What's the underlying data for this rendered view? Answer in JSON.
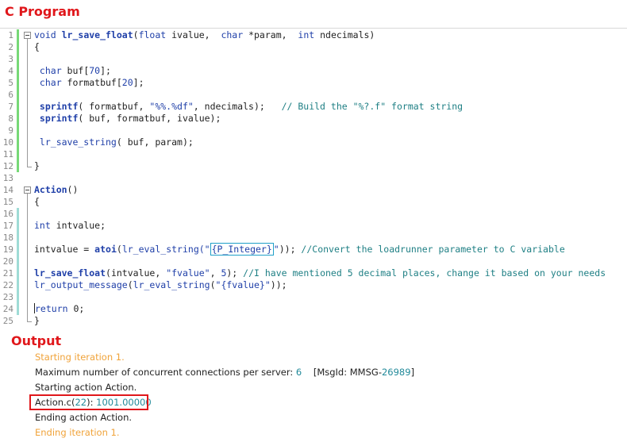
{
  "titles": {
    "code": "C Program",
    "output": "Output"
  },
  "code_lines": [
    {
      "n": "1",
      "tokens": [
        {
          "t": "void ",
          "c": "kw"
        },
        {
          "t": "lr_save_float",
          "c": "fn"
        },
        {
          "t": "(",
          "c": ""
        },
        {
          "t": "float",
          "c": "kw"
        },
        {
          "t": " ivalue,  ",
          "c": ""
        },
        {
          "t": "char",
          "c": "kw"
        },
        {
          "t": " *param,  ",
          "c": ""
        },
        {
          "t": "int",
          "c": "kw"
        },
        {
          "t": " ndecimals)",
          "c": ""
        }
      ]
    },
    {
      "n": "2",
      "tokens": [
        {
          "t": "{",
          "c": ""
        }
      ]
    },
    {
      "n": "3",
      "tokens": []
    },
    {
      "n": "4",
      "tokens": [
        {
          "t": " char",
          "c": "kw"
        },
        {
          "t": " buf[",
          "c": ""
        },
        {
          "t": "70",
          "c": "num"
        },
        {
          "t": "];",
          "c": ""
        }
      ]
    },
    {
      "n": "5",
      "tokens": [
        {
          "t": " char",
          "c": "kw"
        },
        {
          "t": " formatbuf[",
          "c": ""
        },
        {
          "t": "20",
          "c": "num"
        },
        {
          "t": "];",
          "c": ""
        }
      ]
    },
    {
      "n": "6",
      "tokens": []
    },
    {
      "n": "7",
      "tokens": [
        {
          "t": " sprintf",
          "c": "fn"
        },
        {
          "t": "( formatbuf, ",
          "c": ""
        },
        {
          "t": "\"%%.%df\"",
          "c": "str"
        },
        {
          "t": ", ndecimals);   ",
          "c": ""
        },
        {
          "t": "// Build the \"%?.f\" format string",
          "c": "cm"
        }
      ]
    },
    {
      "n": "8",
      "tokens": [
        {
          "t": " sprintf",
          "c": "fn"
        },
        {
          "t": "( buf, formatbuf, ivalue);",
          "c": ""
        }
      ]
    },
    {
      "n": "9",
      "tokens": []
    },
    {
      "n": "10",
      "tokens": [
        {
          "t": " lr_save_string",
          "c": "lr"
        },
        {
          "t": "( buf, param);",
          "c": ""
        }
      ]
    },
    {
      "n": "11",
      "tokens": []
    },
    {
      "n": "12",
      "tokens": [
        {
          "t": "}",
          "c": ""
        }
      ]
    },
    {
      "n": "13",
      "tokens": []
    },
    {
      "n": "14",
      "tokens": [
        {
          "t": "Action",
          "c": "fn"
        },
        {
          "t": "()",
          "c": ""
        }
      ]
    },
    {
      "n": "15",
      "tokens": [
        {
          "t": "{",
          "c": ""
        }
      ]
    },
    {
      "n": "16",
      "tokens": []
    },
    {
      "n": "17",
      "tokens": [
        {
          "t": "int",
          "c": "kw"
        },
        {
          "t": " intvalue;",
          "c": ""
        }
      ]
    },
    {
      "n": "18",
      "tokens": []
    },
    {
      "n": "19",
      "tokens": [
        {
          "t": "intvalue = ",
          "c": ""
        },
        {
          "t": "atoi",
          "c": "fn"
        },
        {
          "t": "(",
          "c": ""
        },
        {
          "t": "lr_eval_string",
          "c": "lr"
        },
        {
          "t": "(\"",
          "c": "str"
        },
        {
          "t": "{P_Integer}",
          "c": "str param"
        },
        {
          "t": "\"",
          "c": "str"
        },
        {
          "t": ")); ",
          "c": ""
        },
        {
          "t": "//Convert the loadrunner parameter to C variable",
          "c": "cm"
        }
      ]
    },
    {
      "n": "20",
      "tokens": []
    },
    {
      "n": "21",
      "tokens": [
        {
          "t": "lr_save_float",
          "c": "fn"
        },
        {
          "t": "(intvalue, ",
          "c": ""
        },
        {
          "t": "\"fvalue\"",
          "c": "str"
        },
        {
          "t": ", ",
          "c": ""
        },
        {
          "t": "5",
          "c": "num"
        },
        {
          "t": "); ",
          "c": ""
        },
        {
          "t": "//I have mentioned 5 decimal places, change it based on your needs",
          "c": "cm"
        }
      ]
    },
    {
      "n": "22",
      "tokens": [
        {
          "t": "lr_output_message",
          "c": "lr"
        },
        {
          "t": "(",
          "c": ""
        },
        {
          "t": "lr_eval_string",
          "c": "lr"
        },
        {
          "t": "(",
          "c": ""
        },
        {
          "t": "\"{fvalue}\"",
          "c": "str"
        },
        {
          "t": "));",
          "c": ""
        }
      ]
    },
    {
      "n": "23",
      "tokens": []
    },
    {
      "n": "24",
      "tokens": [
        {
          "t": "",
          "c": "caret"
        },
        {
          "t": "return",
          "c": "kw"
        },
        {
          "t": " 0;",
          "c": ""
        }
      ]
    },
    {
      "n": "25",
      "tokens": [
        {
          "t": "}",
          "c": ""
        }
      ]
    }
  ],
  "output_lines": [
    {
      "tokens": [
        {
          "t": "Starting iteration 1.",
          "c": "orange"
        }
      ]
    },
    {
      "tokens": [
        {
          "t": "Maximum number of concurrent connections per server: ",
          "c": ""
        },
        {
          "t": "6",
          "c": "teal-t"
        },
        {
          "t": "    [MsgId: MMSG-",
          "c": ""
        },
        {
          "t": "26989",
          "c": "teal-t"
        },
        {
          "t": "]",
          "c": ""
        }
      ]
    },
    {
      "tokens": [
        {
          "t": "Starting action Action.",
          "c": ""
        }
      ]
    },
    {
      "tokens": [
        {
          "t": "Action.c(",
          "c": ""
        },
        {
          "t": "22",
          "c": "teal-t"
        },
        {
          "t": "): ",
          "c": ""
        },
        {
          "t": "1001.00000",
          "c": "teal-t"
        }
      ]
    },
    {
      "tokens": [
        {
          "t": "Ending action Action.",
          "c": ""
        }
      ]
    },
    {
      "tokens": [
        {
          "t": "Ending iteration 1.",
          "c": "orange"
        }
      ]
    }
  ],
  "colors": {
    "title_red": "#e0171b",
    "keyword_blue": "#1f3fa8",
    "comment_teal": "#1e7f84",
    "change_bar_green": "#77d977",
    "change_bar_teal": "#9fdcd6",
    "output_orange": "#f0a33a"
  }
}
